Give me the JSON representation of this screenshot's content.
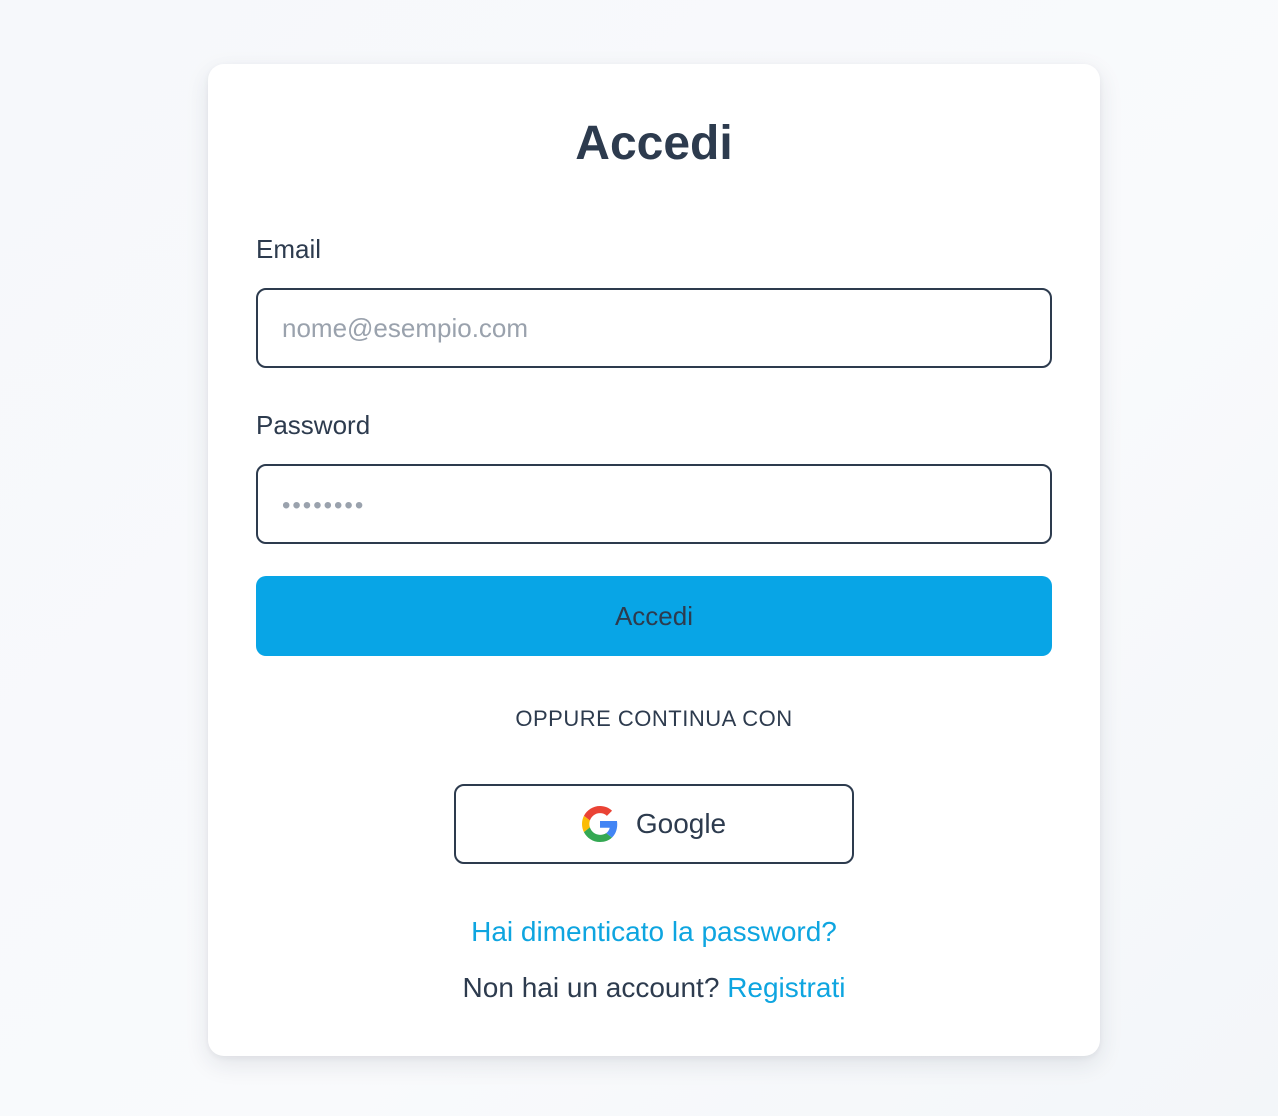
{
  "login": {
    "title": "Accedi",
    "email_label": "Email",
    "email_placeholder": "nome@esempio.com",
    "password_label": "Password",
    "password_placeholder": "••••••••",
    "submit_label": "Accedi",
    "divider_text": "OPPURE CONTINUA CON",
    "google_label": "Google",
    "google_icon": "google-icon",
    "forgot_link": "Hai dimenticato la password?",
    "signup_prompt": "Non hai un account?",
    "signup_link": "Registrati"
  },
  "colors": {
    "accent": "#08a5e6",
    "link": "#0ea5e0",
    "text": "#2d3b4e",
    "placeholder": "#9aa2ad",
    "card": "#ffffff",
    "background": "#f7f9fb"
  }
}
